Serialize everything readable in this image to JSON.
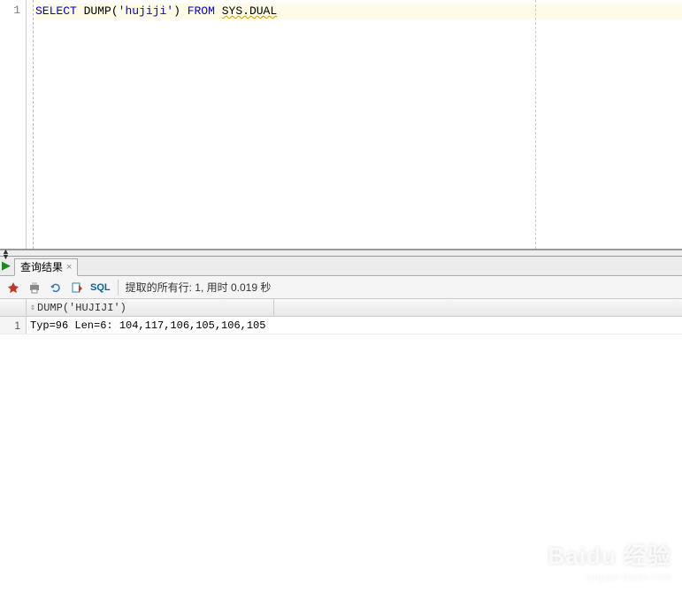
{
  "editor": {
    "line_number": "1",
    "sql": {
      "kw_select": "SELECT",
      "func_dump": "DUMP",
      "paren_open": "(",
      "string_arg": "'hujiji'",
      "paren_close": ")",
      "kw_from": "FROM",
      "table": "SYS.DUAL"
    }
  },
  "tabs": {
    "result_tab_label": "查询结果",
    "close_glyph": "×"
  },
  "toolbar": {
    "pin_icon": "📌",
    "print_icon": "🖨",
    "refresh_icon": "🔄",
    "export_icon": "📑",
    "sql_label": "SQL",
    "status_prefix": "提取的所有行: ",
    "row_count": "1",
    "status_mid": ", 用时 ",
    "elapsed": "0.019",
    "status_suffix": " 秒"
  },
  "grid": {
    "column_header": "DUMP('HUJIJI')",
    "rows": [
      {
        "n": "1",
        "value": "Typ=96 Len=6: 104,117,106,105,106,105"
      }
    ]
  },
  "watermark": {
    "main": "Baidu 经验",
    "sub": "jingyan.baidu.com"
  }
}
